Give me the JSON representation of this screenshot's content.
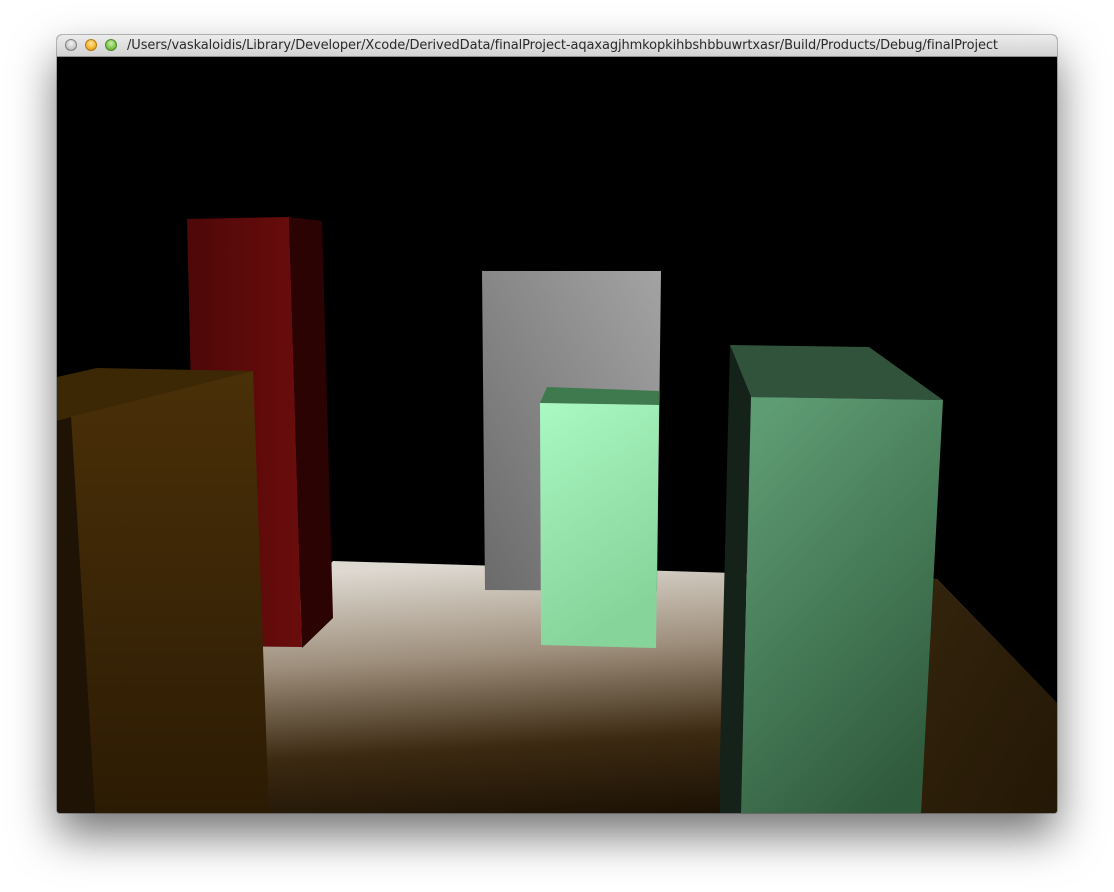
{
  "window": {
    "title": "/Users/vaskaloidis/Library/Developer/Xcode/DerivedData/finalProject-aqaxagjhmkopkihbshbbuwrtxasr/Build/Products/Debug/finalProject",
    "controls": [
      "close",
      "minimize",
      "zoom"
    ]
  },
  "scene": {
    "background_color": "#000000",
    "objects": [
      {
        "name": "floor",
        "color": "#d8d2c8"
      },
      {
        "name": "red-box",
        "color": "#6b0c0c"
      },
      {
        "name": "gray-box",
        "color": "#9a9a9a"
      },
      {
        "name": "mint-box",
        "color": "#a6f6be"
      },
      {
        "name": "green-box",
        "color": "#5a9a70"
      },
      {
        "name": "brown-box",
        "color": "#4a3008"
      }
    ]
  }
}
